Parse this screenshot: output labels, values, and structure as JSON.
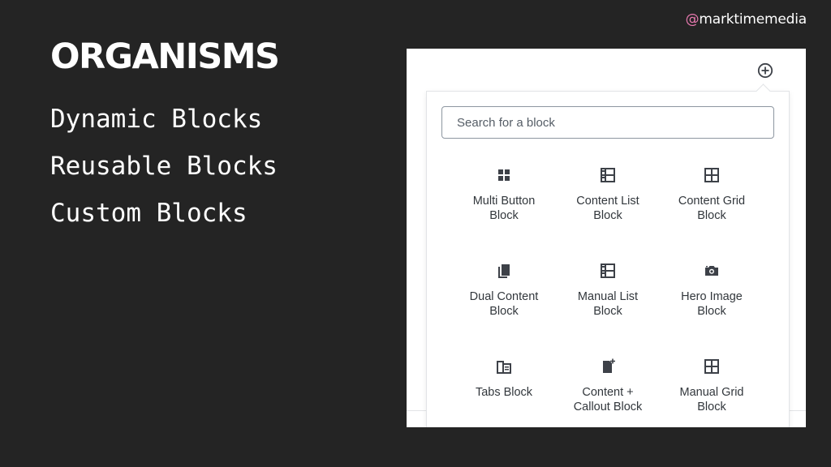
{
  "slide": {
    "handle_at": "@",
    "handle_name": "marktimemedia",
    "title": "ORGANISMS",
    "bullets": [
      "Dynamic Blocks",
      "Reusable Blocks",
      "Custom Blocks"
    ]
  },
  "editor": {
    "toggle_icon": "plus-circle-icon",
    "search": {
      "placeholder": "Search for a block",
      "value": ""
    },
    "blocks": [
      {
        "line1": "Multi Button",
        "line2": "Block",
        "icon": "grid-squares-icon"
      },
      {
        "line1": "Content List",
        "line2": "Block",
        "icon": "list-layout-icon"
      },
      {
        "line1": "Content Grid",
        "line2": "Block",
        "icon": "grid-layout-icon"
      },
      {
        "line1": "Dual Content",
        "line2": "Block",
        "icon": "stacked-pages-icon"
      },
      {
        "line1": "Manual List",
        "line2": "Block",
        "icon": "list-layout-icon"
      },
      {
        "line1": "Hero Image",
        "line2": "Block",
        "icon": "camera-icon"
      },
      {
        "line1": "Tabs Block",
        "line2": "",
        "icon": "tabs-icon"
      },
      {
        "line1": "Content +",
        "line2": "Callout Block",
        "icon": "document-plus-icon"
      },
      {
        "line1": "Manual Grid",
        "line2": "Block",
        "icon": "grid-layout-icon"
      }
    ]
  },
  "colors": {
    "background": "#242424",
    "text": "#ffffff",
    "handle_accent": "#e97ab0",
    "icon": "#3d4148",
    "block_label": "#32373c"
  }
}
